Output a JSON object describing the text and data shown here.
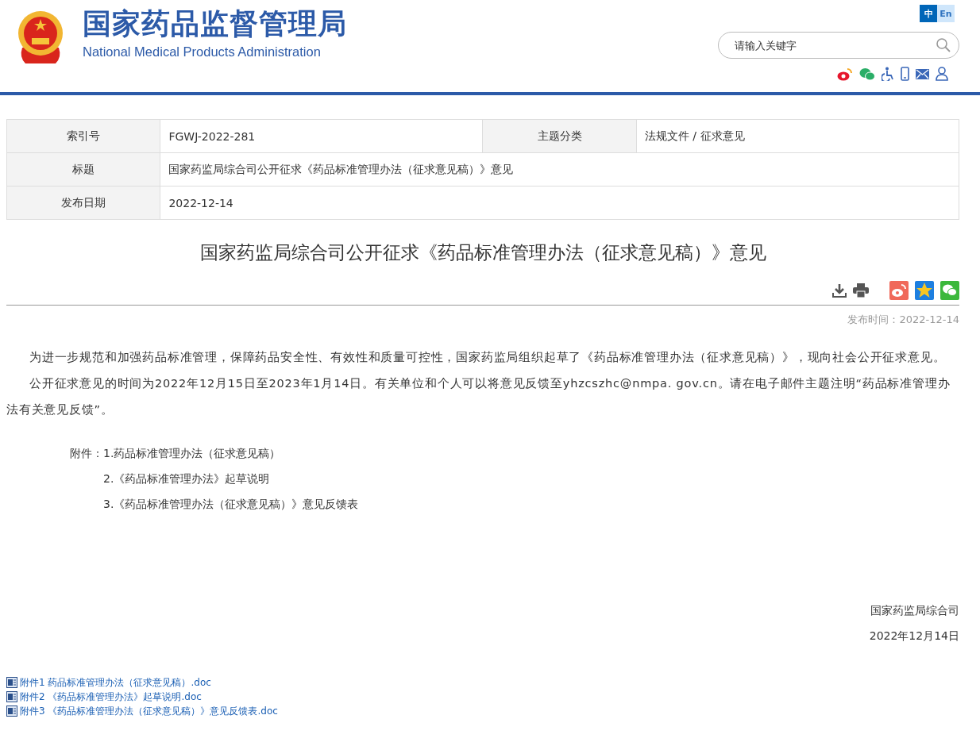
{
  "header": {
    "title": "国家药品监督管理局",
    "subtitle": "National Medical Products Administration",
    "languages": [
      {
        "label": "中",
        "selected": true
      },
      {
        "label": "En",
        "selected": false
      }
    ],
    "search": {
      "placeholder": "请输入关键字"
    }
  },
  "meta_table": {
    "rows": [
      {
        "cells": [
          {
            "label": "索引号",
            "value": "FGWJ-2022-281"
          },
          {
            "label": "主题分类",
            "value": "法规文件 / 征求意见"
          }
        ]
      },
      {
        "cells": [
          {
            "label": "标题",
            "value": "国家药监局综合司公开征求《药品标准管理办法（征求意见稿）》意见"
          }
        ]
      },
      {
        "cells": [
          {
            "label": "发布日期",
            "value": "2022-12-14"
          }
        ]
      }
    ]
  },
  "article": {
    "title": "国家药监局综合司公开征求《药品标准管理办法（征求意见稿）》意见",
    "publish_time": "发布时间：2022-12-14",
    "paragraphs": [
      "为进一步规范和加强药品标准管理，保障药品安全性、有效性和质量可控性，国家药监局组织起草了《药品标准管理办法（征求意见稿）》，现向社会公开征求意见。",
      "公开征求意见的时间为2022年12月15日至2023年1月14日。有关单位和个人可以将意见反馈至yhzcszhc@nmpa. gov.cn。请在电子邮件主题注明“药品标准管理办法有关意见反馈”。"
    ],
    "attachment_label": "附件：",
    "attachment_items": [
      "1.药品标准管理办法（征求意见稿）",
      "2.《药品标准管理办法》起草说明",
      "3.《药品标准管理办法（征求意见稿）》意见反馈表"
    ],
    "signature": "国家药监局综合司",
    "date": "2022年12月14日",
    "files": [
      "附件1 药品标准管理办法（征求意见稿）.doc",
      "附件2 《药品标准管理办法》起草说明.doc",
      "附件3 《药品标准管理办法（征求意见稿）》意见反馈表.doc"
    ]
  }
}
